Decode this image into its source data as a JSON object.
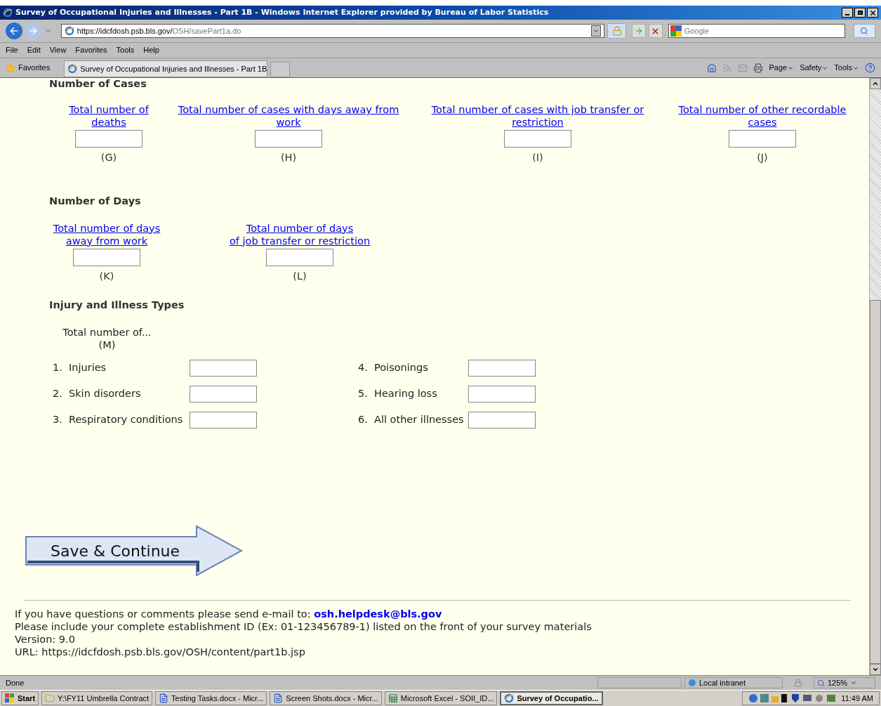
{
  "window": {
    "title": "Survey of Occupational Injuries and Illnesses - Part 1B - Windows Internet Explorer provided by Bureau of Labor Statistics"
  },
  "address_bar": {
    "host": "https://idcfdosh.psb.bls.gov/",
    "path": "OSH/savePart1a.do"
  },
  "search": {
    "placeholder": "Google"
  },
  "menu": [
    "File",
    "Edit",
    "View",
    "Favorites",
    "Tools",
    "Help"
  ],
  "favorites_bar": {
    "favorites": "Favorites",
    "tab": "Survey of Occupational Injuries and Illnesses - Part 1B",
    "commands": [
      "Page",
      "Safety",
      "Tools"
    ]
  },
  "cases": {
    "heading": "Number of Cases",
    "fields": [
      {
        "label": "Total number of\ndeaths",
        "letter": "(G)"
      },
      {
        "label": "Total number of cases with days away from\nwork",
        "letter": "(H)"
      },
      {
        "label": "Total number of cases with job transfer or\nrestriction",
        "letter": "(I)"
      },
      {
        "label": "Total number of other recordable\ncases",
        "letter": "(J)"
      }
    ]
  },
  "days": {
    "heading": "Number of Days",
    "fields": [
      {
        "label": "Total number of days\naway from work",
        "letter": "(K)"
      },
      {
        "label": "Total number of days\nof job transfer or restriction",
        "letter": "(L)"
      }
    ]
  },
  "types": {
    "heading": "Injury and Illness Types",
    "total_label": "Total number of...",
    "total_letter": "(M)",
    "items": [
      {
        "number": "1.",
        "label": "Injuries"
      },
      {
        "number": "4.",
        "label": "Poisonings"
      },
      {
        "number": "2.",
        "label": "Skin disorders"
      },
      {
        "number": "5.",
        "label": "Hearing loss"
      },
      {
        "number": "3.",
        "label": "Respiratory conditions"
      },
      {
        "number": "6.",
        "label": "All other illnesses"
      }
    ]
  },
  "save_button": "Save & Continue",
  "footer": {
    "contact": "If you have questions or comments please send e-mail to:",
    "email": "osh.helpdesk@bls.gov",
    "lines": [
      "Please include your complete establishment ID (Ex: 01-123456789-1) listed on the front of your survey materials",
      "Version: 9.0",
      "URL: https://idcfdosh.psb.bls.gov/OSH/content/part1b.jsp"
    ]
  },
  "status_bar": {
    "text": "Done",
    "zone": "Local intranet",
    "zoom": "125%"
  },
  "taskbar": {
    "start": "Start",
    "items": [
      {
        "label": "Y:\\FY11 Umbrella Contract",
        "kind": "folder",
        "selected": false
      },
      {
        "label": "Testing Tasks.docx - Micr...",
        "kind": "word",
        "selected": false
      },
      {
        "label": "Screen Shots.docx - Micr...",
        "kind": "word",
        "selected": false
      },
      {
        "label": "Microsoft Excel - SOII_ID...",
        "kind": "excel",
        "selected": false
      },
      {
        "label": "Survey of Occupatio...",
        "kind": "browser",
        "selected": true
      }
    ],
    "clock": "11:49 AM"
  }
}
